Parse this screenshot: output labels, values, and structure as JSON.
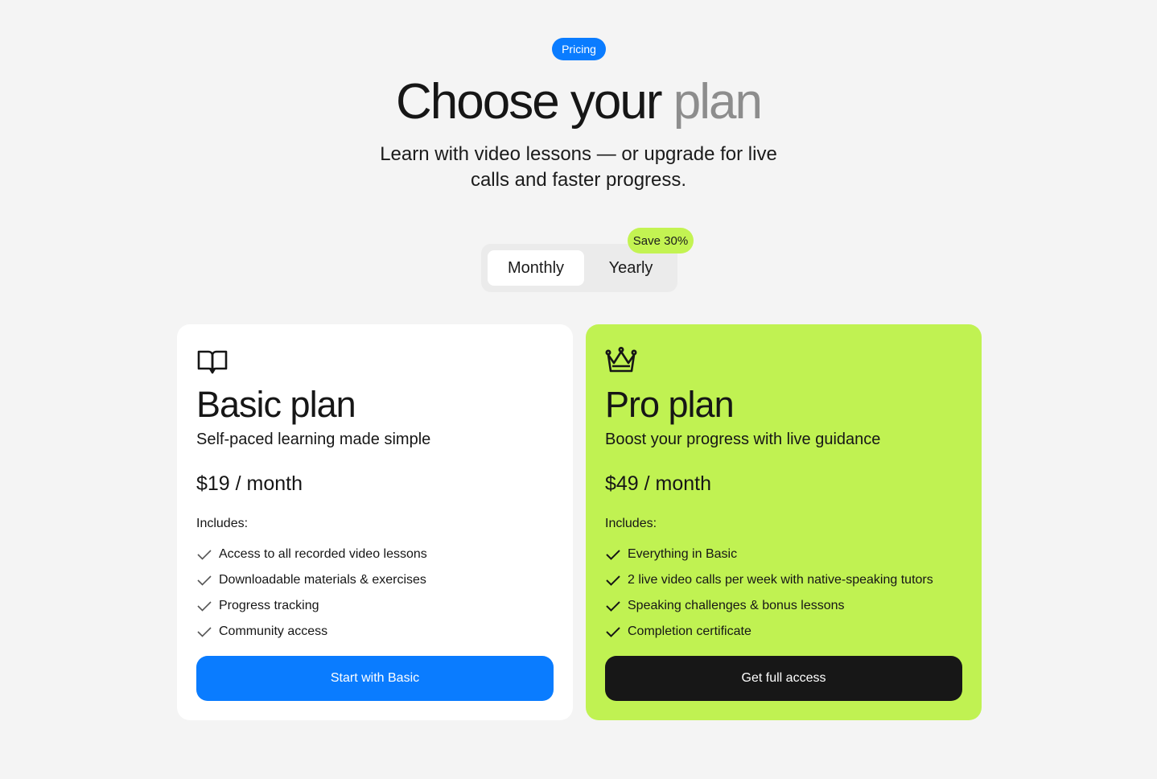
{
  "header": {
    "pill_label": "Pricing",
    "title_main": "Choose your",
    "title_muted": "plan",
    "subtitle": "Learn with video lessons — or upgrade for live calls and faster progress."
  },
  "billing_toggle": {
    "options": [
      "Monthly",
      "Yearly"
    ],
    "selected": "Monthly",
    "save_badge": "Save 30%"
  },
  "plans": [
    {
      "icon": "book-icon",
      "title": "Basic plan",
      "description": "Self-paced learning made simple",
      "price": "$19 / month",
      "includes_label": "Includes:",
      "features": [
        "Access to all recorded video lessons",
        "Downloadable materials & exercises",
        "Progress tracking",
        "Community access"
      ],
      "cta": "Start with Basic"
    },
    {
      "icon": "crown-icon",
      "title": "Pro plan",
      "description": "Boost your progress with live guidance",
      "price": "$49 / month",
      "includes_label": "Includes:",
      "features": [
        "Everything in Basic",
        "2 live video calls per week with native-speaking tutors",
        "Speaking challenges & bonus lessons",
        "Completion certificate"
      ],
      "cta": "Get full access"
    }
  ],
  "colors": {
    "background": "#f4f4f4",
    "accent_blue": "#0a7cff",
    "accent_lime": "#c0f252",
    "dark_button": "#171717",
    "muted_text": "#8d8d8d"
  }
}
